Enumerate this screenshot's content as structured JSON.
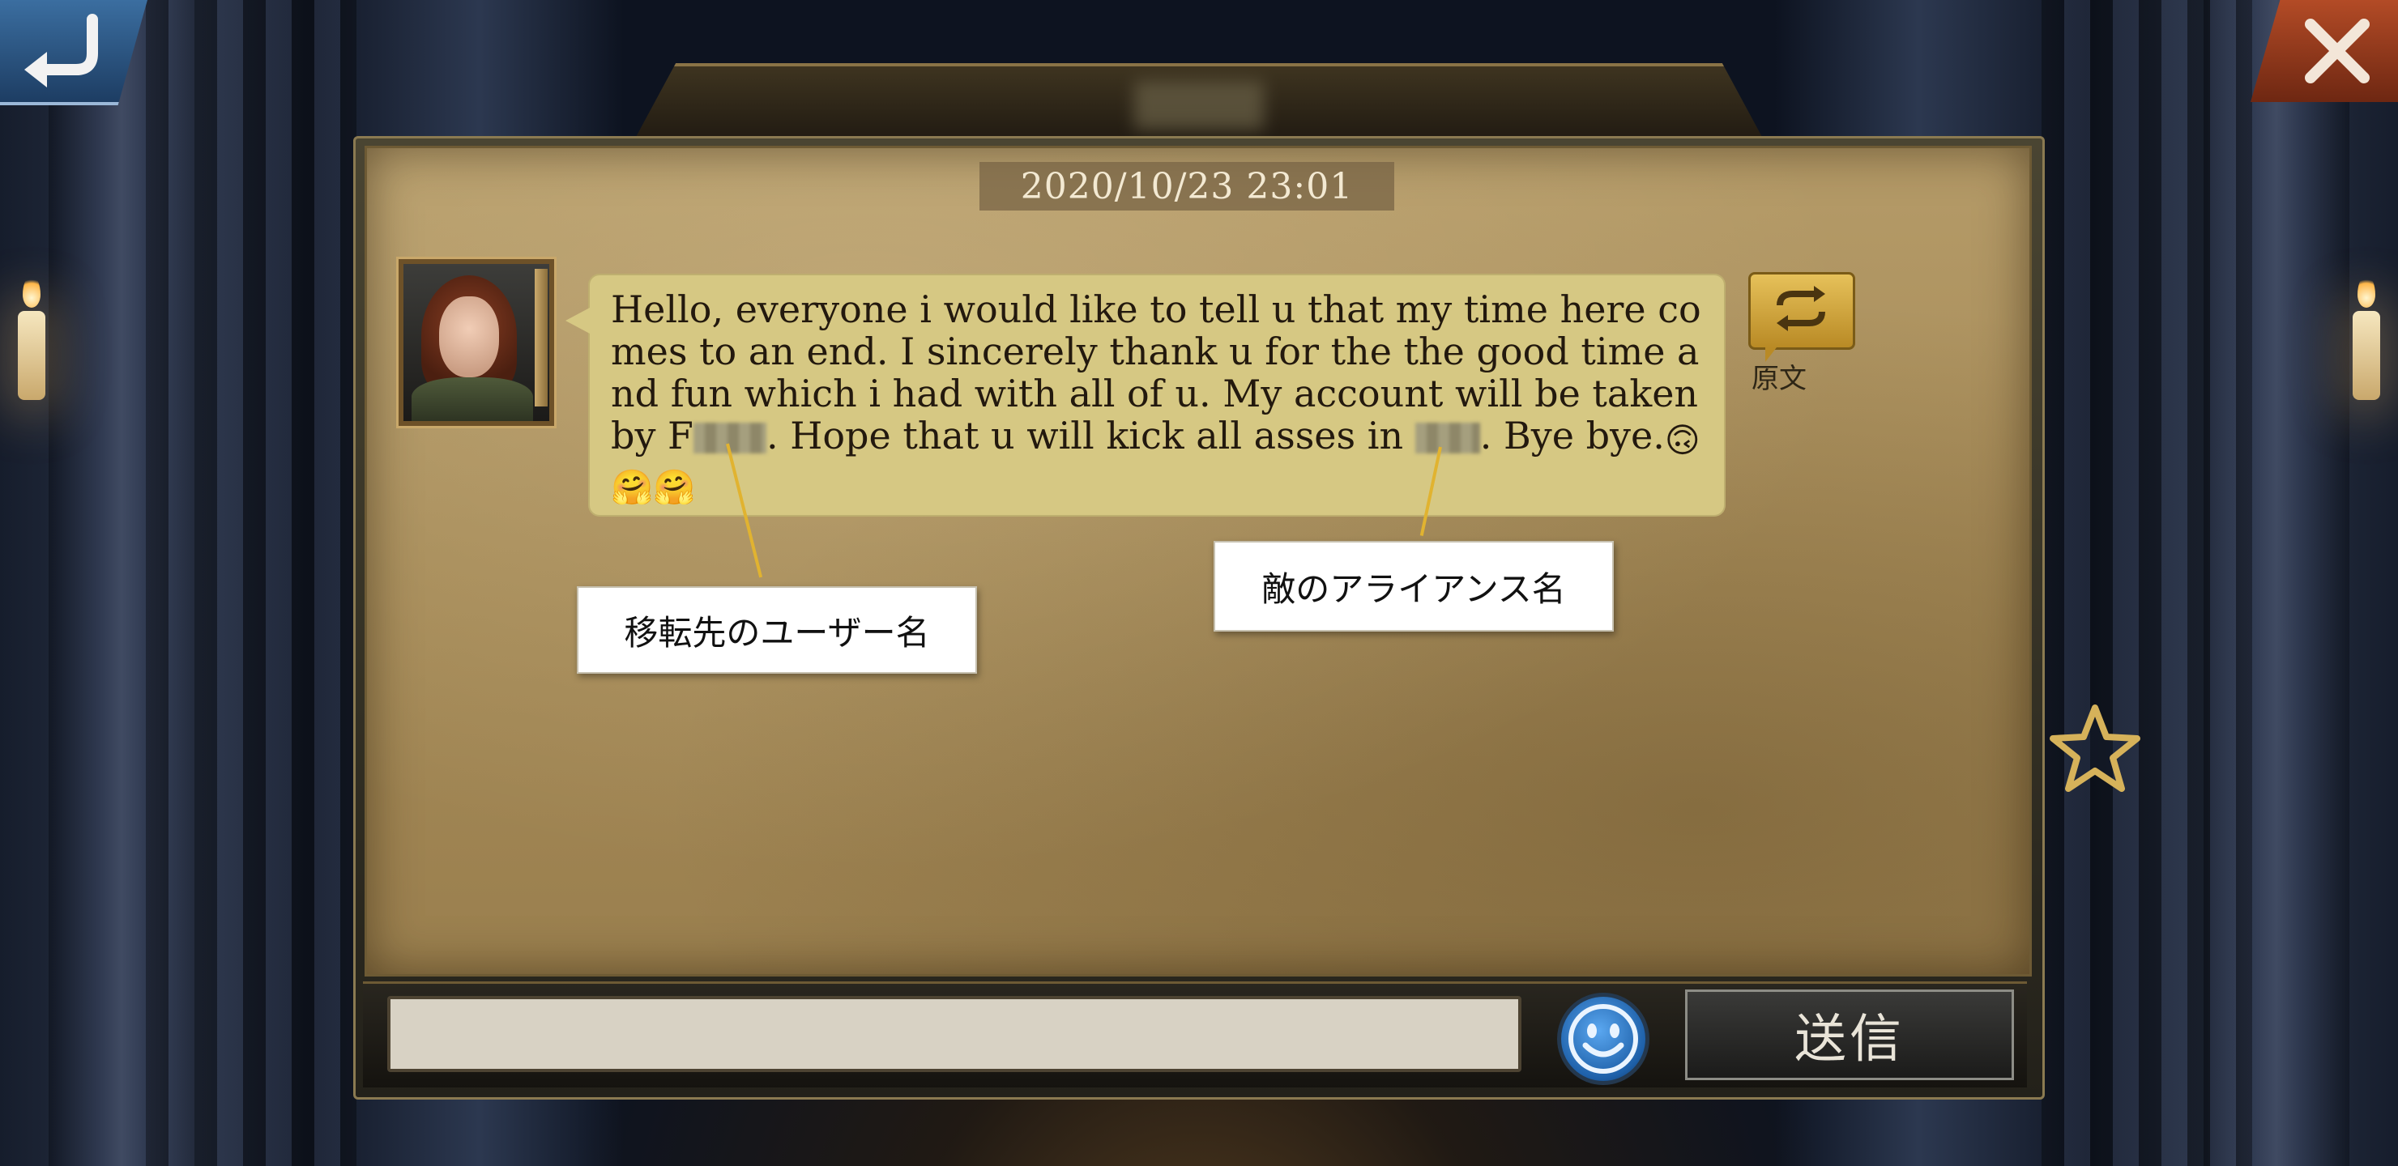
{
  "header": {
    "back_icon": "back-arrow-icon",
    "close_icon": "close-icon"
  },
  "message": {
    "timestamp": "2020/10/23 23:01",
    "text_line1": "Hello, everyone i would like to tell u that my time here co",
    "text_line2": "mes to an end. I sincerely thank u for the the good time a",
    "text_line3": "nd fun which i had with all of u. My account will be taken",
    "text_line4_a": "by F",
    "text_line4_b": ". Hope that u will kick all asses in ",
    "text_line4_c": ". Bye bye.",
    "emoji_upside_down": "🙃",
    "emoji_hug_1": "🤗",
    "emoji_hug_2": "🤗",
    "translate_icon": "translate-swap-icon",
    "original_label": "原文"
  },
  "annotations": {
    "target_username": "移転先のユーザー名",
    "enemy_alliance": "敵のアライアンス名"
  },
  "composer": {
    "input_value": "",
    "emoji_icon": "smiley-icon",
    "send_label": "送信"
  },
  "side": {
    "favorite_icon": "star-icon"
  }
}
